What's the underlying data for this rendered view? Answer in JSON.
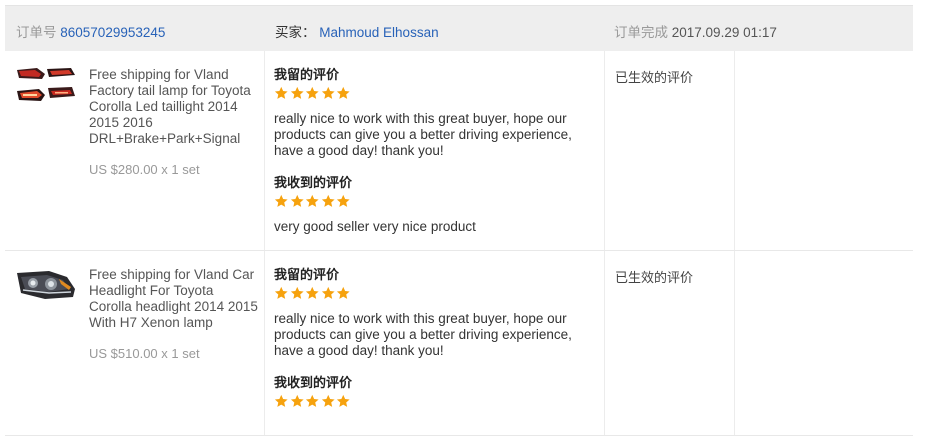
{
  "header": {
    "order_label": "订单号",
    "order_number": "86057029953245",
    "buyer_label": "买家：",
    "buyer_name": "Mahmoud Elhossan",
    "completed_label": "订单完成",
    "completed_time": "2017.09.29 01:17"
  },
  "orders": [
    {
      "image": "tail-lamp-product",
      "title": "Free shipping for Vland Factory tail lamp for Toyota Corolla Led taillight 2014 2015 2016 DRL+Brake+Park+Signal",
      "price": "US $280.00 x 1 set",
      "left_label": "我留的评价",
      "left_rating": 5,
      "left_text": "really nice to work with this great buyer, hope our products can give you a better driving experience, have a good day! thank you!",
      "received_label": "我收到的评价",
      "received_rating": 5,
      "received_text": "very good seller very nice product",
      "status": "已生效的评价"
    },
    {
      "image": "headlight-product",
      "title": "Free shipping for Vland Car Headlight For Toyota Corolla headlight 2014 2015 With H7 Xenon lamp",
      "price": "US $510.00 x 1 set",
      "left_label": "我留的评价",
      "left_rating": 5,
      "left_text": "really nice to work with this great buyer, hope our products can give you a better driving experience, have a good day! thank you!",
      "received_label": "我收到的评价",
      "received_rating": 5,
      "received_text": "",
      "status": "已生效的评价"
    }
  ],
  "colors": {
    "star": "#f6a20e",
    "link": "#2862b8",
    "header_bg": "#eeeeee"
  },
  "icons": {
    "rating": "star-icon"
  }
}
